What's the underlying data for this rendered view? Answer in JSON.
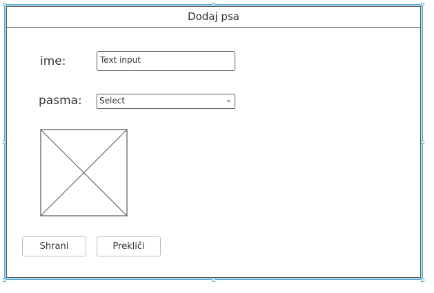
{
  "dialog": {
    "title": "Dodaj psa"
  },
  "form": {
    "name_label": "ime:",
    "name_input_value": "Text input",
    "breed_label": "pasma:",
    "breed_select_value": "Select"
  },
  "image": {
    "icon": "image-placeholder-icon"
  },
  "buttons": {
    "save_label": "Shrani",
    "cancel_label": "Prekliči"
  },
  "colors": {
    "selection_border": "#5aaed0",
    "sketch_line": "#555555",
    "button_border": "#bbbbbb"
  }
}
